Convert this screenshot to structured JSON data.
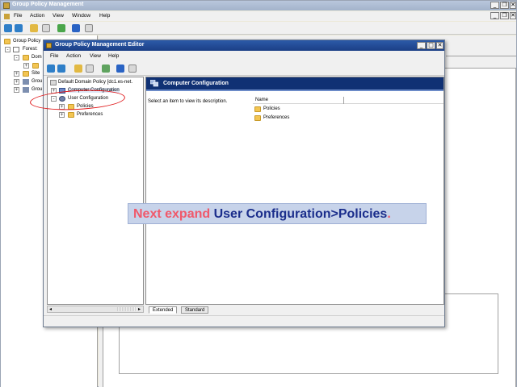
{
  "outer": {
    "title": "Group Policy Management",
    "menu": [
      "File",
      "Action",
      "View",
      "Window",
      "Help"
    ],
    "tree": {
      "root": "Group Policy",
      "forest": "Forest:",
      "domain": "Dom",
      "sites": "Site",
      "gpm": "Grou",
      "gpr": "Grou"
    }
  },
  "editor": {
    "title": "Group Policy Management Editor",
    "menu": [
      "File",
      "Action",
      "View",
      "Help"
    ],
    "tree": {
      "root": "Default Domain Policy [dc1.es-net.",
      "computer_config": "Computer Configuration",
      "user_config": "User Configuration",
      "policies": "Policies",
      "preferences": "Preferences"
    },
    "banner_title": "Computer Configuration",
    "description": "Select an item to view its description.",
    "list": {
      "column_name": "Name",
      "items": [
        "Policies",
        "Preferences"
      ]
    },
    "tabs": [
      "Extended",
      "Standard"
    ]
  },
  "caption": {
    "part1": "Next expand ",
    "part2": "User Configuration>Policies",
    "part3": "."
  },
  "colors": {
    "editor_title": "#1b3f86",
    "banner": "#103174",
    "caption_red": "#f0596b",
    "caption_blue": "#1b2e8c",
    "highlight": "#e0181a"
  }
}
